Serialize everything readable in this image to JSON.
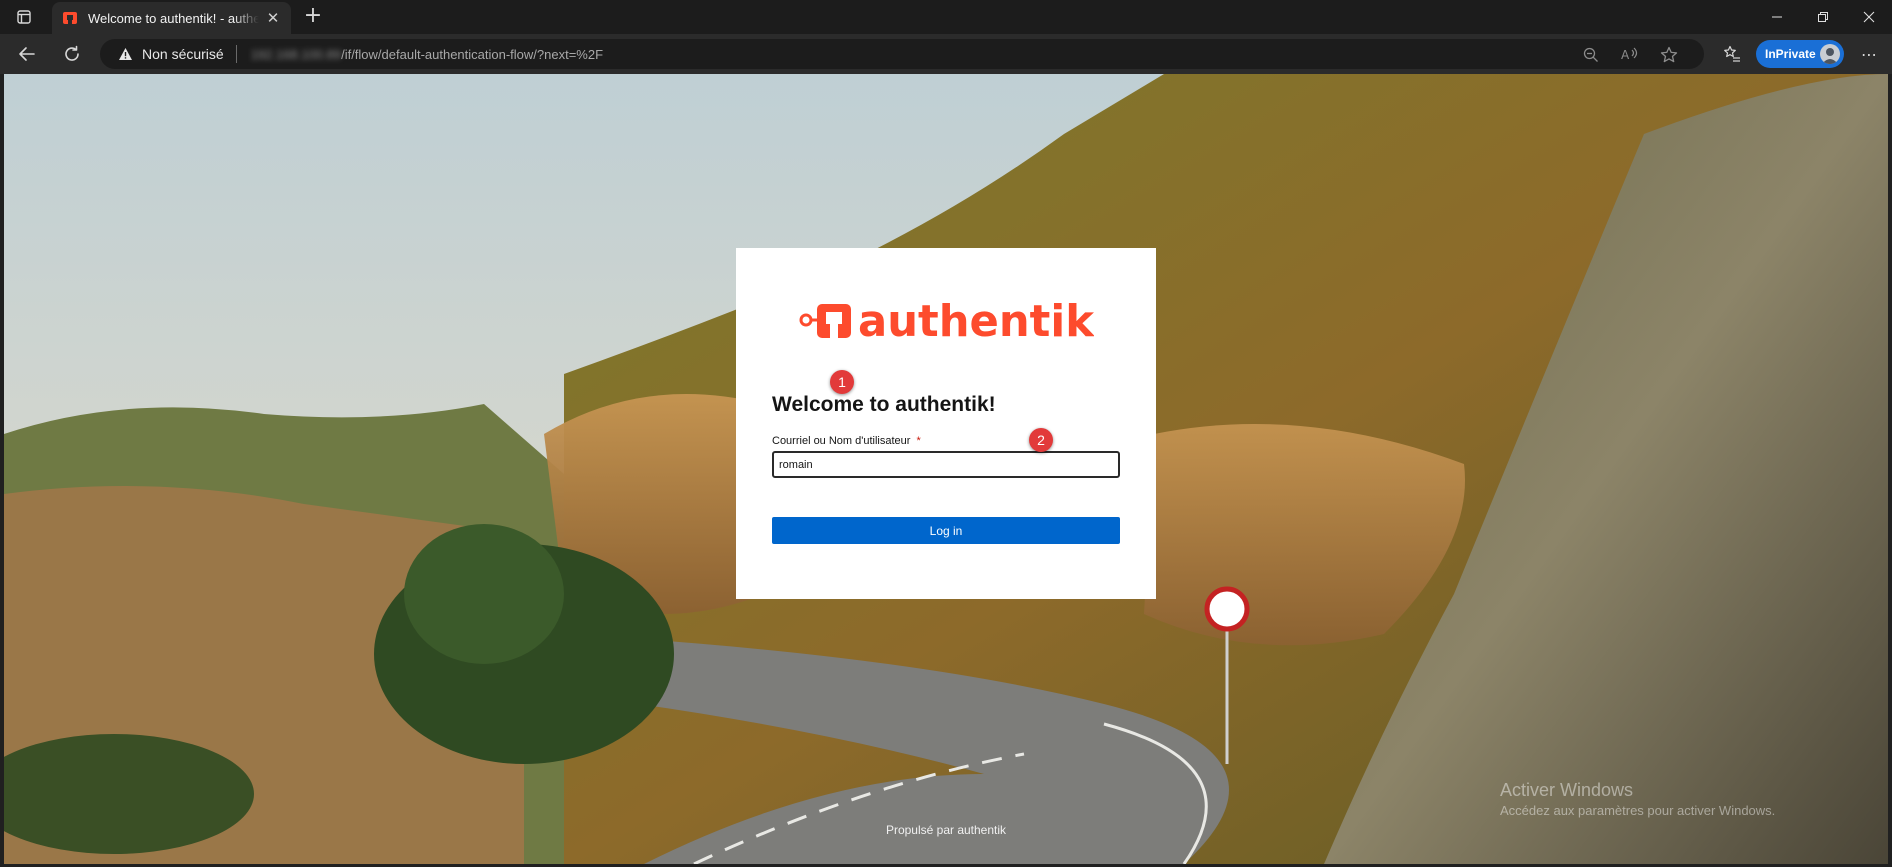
{
  "browser": {
    "tab": {
      "title": "Welcome to authentik! - authentik",
      "close_glyph": "✕"
    },
    "new_tab_glyph": "+",
    "window_controls": {
      "minimize": "—",
      "restore": "❐",
      "close": "✕"
    },
    "address": {
      "security_label": "Non sécurisé",
      "host": "192.168.100.89",
      "path": "/if/flow/default-authentication-flow/?next=%2F"
    },
    "inprivate_label": "InPrivate",
    "more_glyph": "⋯"
  },
  "login": {
    "brand": "authentik",
    "heading": "Welcome to authentik!",
    "username_label": "Courriel ou Nom d'utilisateur",
    "required_mark": "*",
    "username_value": "romain",
    "login_button": "Log in"
  },
  "annotations": {
    "marker_1": "1",
    "marker_2": "2"
  },
  "footer": {
    "powered_by": "Propulsé par authentik"
  },
  "windows_activation": {
    "title": "Activer Windows",
    "subtitle": "Accédez aux paramètres pour activer Windows."
  },
  "colors": {
    "brand": "#fd4b2d",
    "primary_button": "#0066cc",
    "inprivate": "#1a6fd6",
    "marker": "#e23a3a"
  },
  "icons": [
    "tab-actions-icon",
    "authentik-favicon",
    "back-arrow-icon",
    "refresh-icon",
    "warning-icon",
    "zoom-out-icon",
    "read-aloud-icon",
    "favorite-star-icon",
    "favorites-bar-icon",
    "profile-avatar-icon"
  ]
}
